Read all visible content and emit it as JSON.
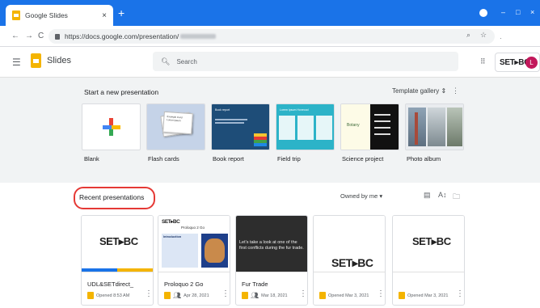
{
  "browser": {
    "tab_title": "Google Slides",
    "tab_close": "×",
    "new_tab": "+",
    "url": "https://docs.google.com/presentation/",
    "nav_back": "←",
    "nav_forward": "→",
    "nav_reload": "C",
    "zoom_icon": "⌕",
    "star_icon": "☆",
    "minimize": "–",
    "maximize": "□",
    "close": "×"
  },
  "header": {
    "app_name": "Slides",
    "search_placeholder": "Search",
    "brand": "SET▸BC",
    "avatar_letter": "L"
  },
  "start": {
    "title": "Start a new presentation",
    "template_gallery": "Template gallery",
    "templates": [
      {
        "label": "Blank"
      },
      {
        "label": "Flash cards"
      },
      {
        "label": "Book report"
      },
      {
        "label": "Field trip"
      },
      {
        "label": "Science project"
      },
      {
        "label": "Photo album"
      }
    ],
    "book_report_title": "Book report",
    "field_trip_title": "Lorem Ipsum Honeood",
    "science_title": "Botany",
    "flash_card_text": "Example Card Lorem ipsum"
  },
  "recent": {
    "title": "Recent presentations",
    "owner_filter": "Owned by me",
    "docs": [
      {
        "title": "UDL&SETdirect_",
        "opened": "Opened 8:53 AM",
        "thumb_text": "SET▸BC"
      },
      {
        "title": "Proloquo 2 Go",
        "opened": "Apr 28, 2021",
        "thumb_text": "SET▸BC",
        "thumb_sub": "Proloquo 2 Go",
        "thumb_intro": "Introduction"
      },
      {
        "title": "Fur Trade",
        "opened": "Mar 18, 2021",
        "thumb_text": "Let's take a look at one of the first conflicts during the fur trade."
      },
      {
        "title": "",
        "opened": "Opened Mar 3, 2021",
        "thumb_text": "SET▸BC"
      },
      {
        "title": "",
        "opened": "Opened Mar 3, 2021",
        "thumb_text": "SET▸BC"
      }
    ]
  }
}
